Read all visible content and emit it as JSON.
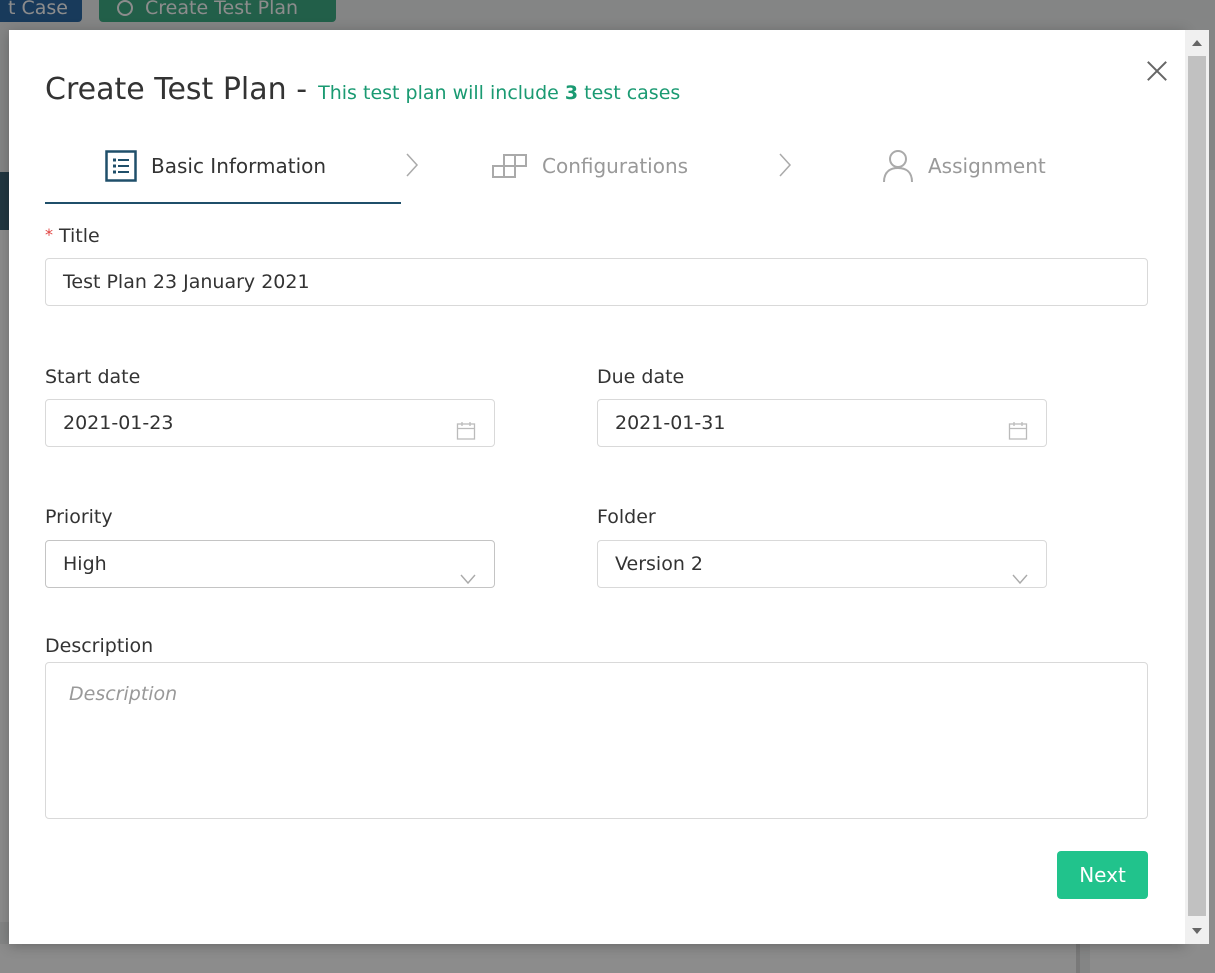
{
  "background": {
    "btn_case": "t Case",
    "btn_create": "Create Test Plan"
  },
  "modal": {
    "title": "Create Test Plan -",
    "subtitle_prefix": "This test plan will include",
    "subtitle_count": "3",
    "subtitle_suffix": "test cases",
    "steps": [
      {
        "label": "Basic Information",
        "icon": "list-icon",
        "active": true
      },
      {
        "label": "Configurations",
        "icon": "blocks-icon",
        "active": false
      },
      {
        "label": "Assignment",
        "icon": "user-icon",
        "active": false
      }
    ],
    "form": {
      "title_label": "Title",
      "title_required_mark": "*",
      "title_value": "Test Plan 23 January 2021",
      "start_date_label": "Start date",
      "start_date_value": "2021-01-23",
      "due_date_label": "Due date",
      "due_date_value": "2021-01-31",
      "priority_label": "Priority",
      "priority_value": "High",
      "folder_label": "Folder",
      "folder_value": "Version 2",
      "description_label": "Description",
      "description_placeholder": "Description"
    },
    "next_label": "Next"
  },
  "colors": {
    "accent_green": "#21c38c",
    "subtitle_green": "#1a9a72",
    "step_active": "#1f4f6a",
    "required": "#e0413e"
  }
}
